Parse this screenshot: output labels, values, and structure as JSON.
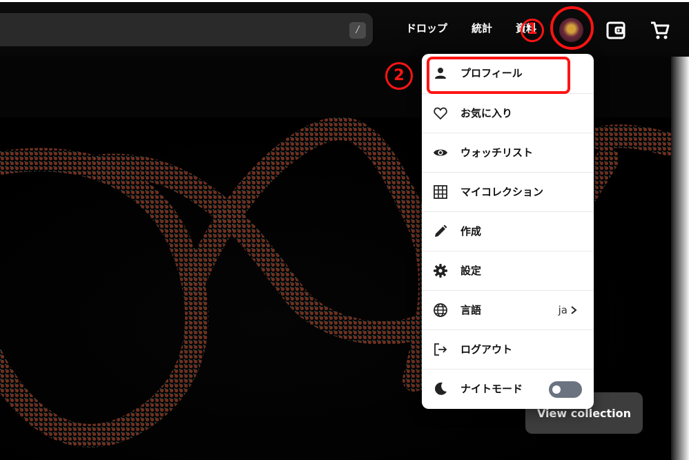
{
  "search": {
    "placeholder": "",
    "shortcut_key": "/"
  },
  "nav": {
    "drops_label": "ドロップ",
    "stats_label": "統計",
    "resources_label": "資料"
  },
  "menu": {
    "items": [
      {
        "id": "profile",
        "icon": "person-icon",
        "label": "プロフィール"
      },
      {
        "id": "favorites",
        "icon": "heart-icon",
        "label": "お気に入り"
      },
      {
        "id": "watchlist",
        "icon": "eye-icon",
        "label": "ウォッチリスト"
      },
      {
        "id": "collections",
        "icon": "grid-icon",
        "label": "マイコレクション"
      },
      {
        "id": "create",
        "icon": "pencil-icon",
        "label": "作成"
      },
      {
        "id": "settings",
        "icon": "gear-icon",
        "label": "設定"
      },
      {
        "id": "language",
        "icon": "globe-icon",
        "label": "言語",
        "value": "ja"
      },
      {
        "id": "logout",
        "icon": "logout-icon",
        "label": "ログアウト"
      },
      {
        "id": "night-mode",
        "icon": "moon-icon",
        "label": "ナイトモード",
        "toggle_on": false
      }
    ]
  },
  "hero": {
    "view_collection_label": "View collection"
  },
  "annotations": {
    "step1": "1",
    "step2": "2",
    "color": "#ff1414"
  }
}
